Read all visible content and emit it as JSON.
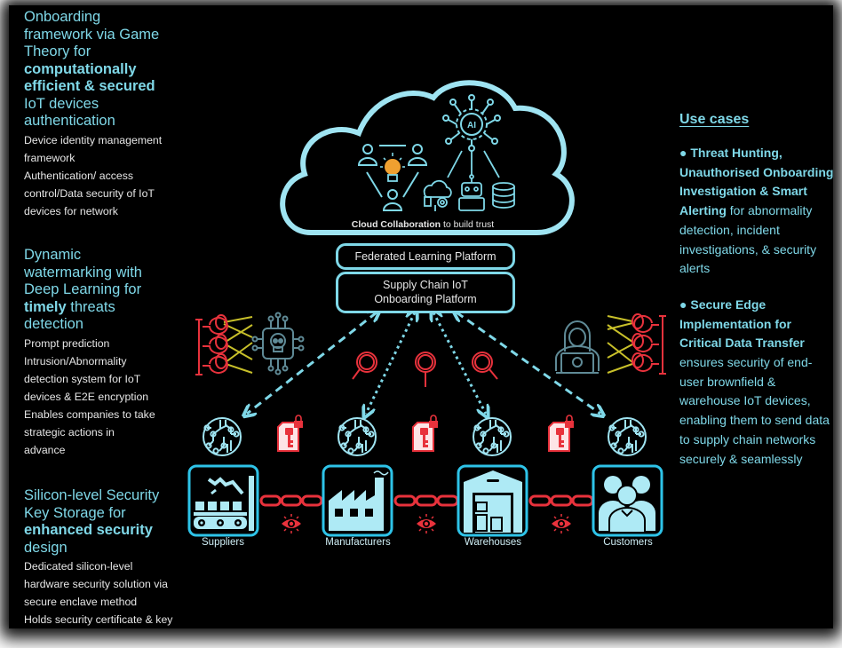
{
  "left_blocks": [
    {
      "title_lines": [
        "Onboarding",
        "framework via Game",
        "Theory for"
      ],
      "title_bold_lines": [
        "computationally",
        "efficient & secured"
      ],
      "title_tail_lines": [
        "IoT devices",
        "authentication"
      ],
      "desc_lines": [
        "Device identity management",
        "framework",
        "Authentication/ access",
        "control/Data security of IoT",
        "devices for network"
      ]
    },
    {
      "title_lines": [
        "Dynamic",
        "watermarking with",
        "Deep Learning for"
      ],
      "title_bold_word": "timely",
      "title_bold_rest": " threats",
      "title_tail_lines": [
        "detection"
      ],
      "desc_lines": [
        "Prompt prediction",
        "Intrusion/Abnormality",
        "detection system for IoT",
        "devices & E2E encryption",
        "Enables companies to take",
        "strategic actions in",
        "advance"
      ]
    },
    {
      "title_lines": [
        "Silicon-level Security",
        "Key Storage for"
      ],
      "title_bold_lines": [
        "enhanced security"
      ],
      "title_tail_lines": [
        "design"
      ],
      "desc_lines": [
        "Dedicated silicon-level",
        "hardware security solution via",
        "secure enclave method",
        "Holds security certificate & key"
      ]
    }
  ],
  "use_cases": {
    "title": "Use cases",
    "items": [
      {
        "bullet": "●",
        "bold": "Threat Hunting, Unauthorised Onboarding Investigation & Smart Alerting",
        "rest": " for abnormality detection, incident investigations, & security alerts"
      },
      {
        "bullet": "●",
        "bold": "Secure Edge Implementation for Critical Data Transfer",
        "rest": " ensures security of end-user brownfield & warehouse IoT devices, enabling them to send data to supply chain networks securely & seamlessly"
      }
    ]
  },
  "cloud": {
    "caption_bold": "Cloud Collaboration",
    "caption_rest": " to build trust",
    "ai_label": "AI"
  },
  "platforms": {
    "federated": "Federated Learning Platform",
    "onboarding_line1": "Supply Chain IoT",
    "onboarding_line2": "Onboarding Platform"
  },
  "nodes": [
    {
      "label": "Suppliers",
      "icon": "conveyor-robot-arm-icon"
    },
    {
      "label": "Manufacturers",
      "icon": "factory-icon"
    },
    {
      "label": "Warehouses",
      "icon": "warehouse-icon"
    },
    {
      "label": "Customers",
      "icon": "customers-icon"
    }
  ],
  "colors": {
    "cyan": "#7fd8e8",
    "red": "#e8323c",
    "yellow": "#c8c02a",
    "bulb": "#f0a030",
    "grey_icon": "#5f8a96"
  }
}
